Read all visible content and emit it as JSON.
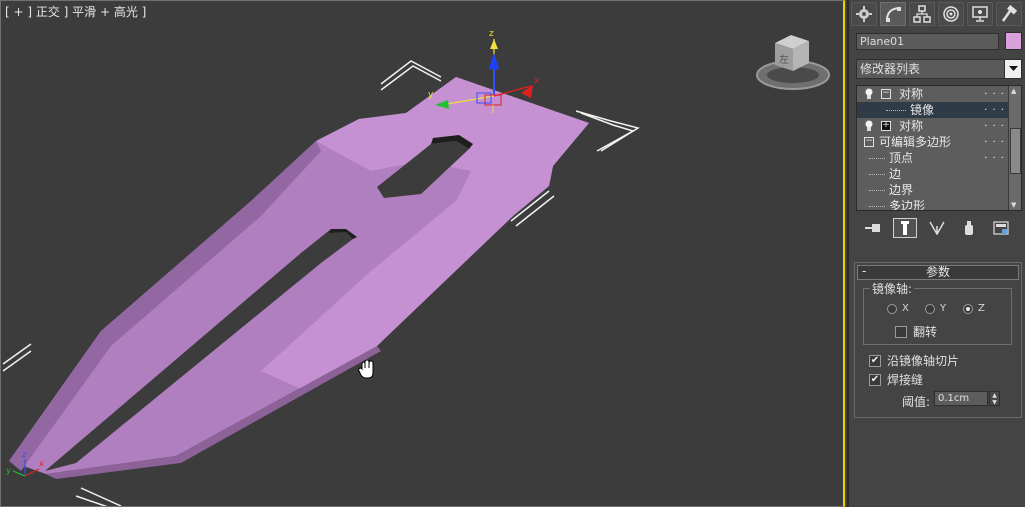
{
  "viewport": {
    "label": "[ + ] 正交 ] 平滑 + 高光 ]",
    "viewcube_face": "左",
    "gizmo_axes": [
      "z",
      "y",
      "x"
    ]
  },
  "object": {
    "name": "Plane01",
    "color": "#d9a0dc",
    "mesh_color": "#c68fd6"
  },
  "command_tabs": [
    "create-icon",
    "modify-icon",
    "hierarchy-icon",
    "motion-icon",
    "display-icon",
    "utilities-icon"
  ],
  "modifier_list": {
    "label": "修改器列表"
  },
  "stack": {
    "rows": [
      {
        "label": "对称",
        "expander": "⊟",
        "has_bulb": true
      },
      {
        "label": "镜像",
        "sub": true,
        "selected": true
      },
      {
        "label": "对称",
        "expander": "⊞",
        "has_bulb": true
      },
      {
        "label": "可编辑多边形",
        "expander": "⊟"
      },
      {
        "label": "顶点",
        "sub": true
      },
      {
        "label": "边",
        "sub": true
      },
      {
        "label": "边界",
        "sub": true
      },
      {
        "label": "多边形",
        "sub": true
      }
    ]
  },
  "params": {
    "title": "参数",
    "mirror_axis_label": "镜像轴:",
    "axes": [
      {
        "label": "X",
        "selected": false
      },
      {
        "label": "Y",
        "selected": false
      },
      {
        "label": "Z",
        "selected": true
      }
    ],
    "flip_label": "翻转",
    "flip_checked": false,
    "slice_label": "沿镜像轴切片",
    "slice_checked": true,
    "weld_label": "焊接缝",
    "weld_checked": true,
    "threshold_label": "阈值:",
    "threshold_value": "0.1cm"
  }
}
